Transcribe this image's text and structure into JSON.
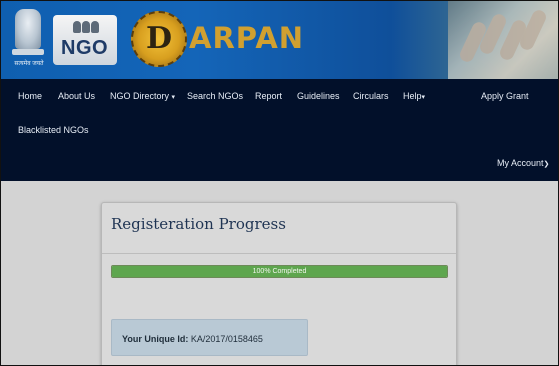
{
  "header": {
    "emblem_motto": "सत्यमेव जयते",
    "ngo_logo_text": "NGO",
    "darpan_first_letter": "D",
    "darpan_rest": "ARPAN"
  },
  "nav": {
    "items": [
      {
        "label": "Home"
      },
      {
        "label": "About Us"
      },
      {
        "label": "NGO Directory"
      },
      {
        "label": "Search NGOs"
      },
      {
        "label": "Report"
      },
      {
        "label": "Guidelines"
      },
      {
        "label": "Circulars"
      },
      {
        "label": "Help"
      },
      {
        "label": "Apply Grant"
      },
      {
        "label": "Blacklisted NGOs"
      },
      {
        "label": "My Account"
      }
    ]
  },
  "panel": {
    "title": "Registeration Progress",
    "progress_percent": 100,
    "progress_label": "100% Completed",
    "uid_label": "Your Unique Id:",
    "uid_value": "KA/2017/0158465"
  },
  "colors": {
    "header_blue": "#1465b8",
    "nav_bg": "#02102a",
    "progress_green": "#5ea64e",
    "uid_box_bg": "#b9c9d5"
  }
}
